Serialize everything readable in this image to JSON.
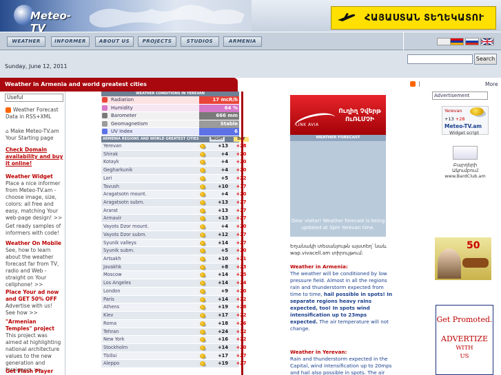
{
  "header": {
    "logo_text": "Meteo-TV",
    "top_ad_text": "ՀԱՅԱՍՏԱՆ ՏԵՂԵԿԱՏՈՒ"
  },
  "nav": {
    "items": [
      "WEATHER",
      "INFORMER",
      "ABOUT US",
      "PROJECTS",
      "STUDIOS",
      "ARMENIA"
    ]
  },
  "search": {
    "button": "Search",
    "value": ""
  },
  "date": "Sunday, June 12, 2011",
  "section_title": "Weather in Armenia and world greatest cities",
  "left": {
    "useful": "Useful",
    "rss_text": "Weather Forecast Data in RSS+XML",
    "start_text": "Make Meteo-TV.am Your Starting page",
    "check_domain": "Check Domain availability and buy it online!",
    "widget_title": "Weather Widget",
    "widget_text": "Place a nice informer from Meteo-TV.am - choose image, size, colors: all free and easy, matching Your web-page design! >>",
    "samples_text": "Get ready samples of informers with code!",
    "mobile_title": "Weather On Mobile",
    "mobile_text": "See, how to learn about the weather forecast far from TV, radio and Web - straight on Your cellphone! >>",
    "ad_title": "Place Your ad now and GET 50% OFF",
    "ad_text": "Advertise with us! See how >>",
    "temples_title": "\"Armenian Temples\" project",
    "temples_text": "This project was aimed at highlighting national architecture values to the new generation and foreigners >>",
    "flash_title": "Get Flash Player"
  },
  "conditions": {
    "header": "WEATHER CONDITIONS IN YEREVAN",
    "rows": [
      {
        "label": "Radiation",
        "value": "17 mcR/h",
        "color": "#e8443a",
        "bg": "#fbe3e3"
      },
      {
        "label": "Humidity",
        "value": "64 %",
        "color": "#d778c8",
        "bg": "#f6e7f3"
      },
      {
        "label": "Barometer",
        "value": "666 mm",
        "color": "#7a7a7a",
        "bg": "#f1f1f1"
      },
      {
        "label": "Geomagnetism",
        "value": "Stable",
        "color": "#9b9b9b",
        "bg": "#f2f2f2"
      },
      {
        "label": "UV Index",
        "value": "6",
        "color": "#5c72e6",
        "bg": "#e6e9fb"
      }
    ]
  },
  "regions": {
    "header": "ARMENIA REGIONS AND WORLD GREATEST CITIES",
    "night_label": "NIGHT",
    "day_label": "DAY",
    "rows": [
      {
        "city": "Yerevan",
        "night": "+13",
        "day": "+28"
      },
      {
        "city": "Shirak",
        "night": "+4",
        "day": "+20"
      },
      {
        "city": "Kotayk",
        "night": "+4",
        "day": "+20"
      },
      {
        "city": "Gegharkunik",
        "night": "+4",
        "day": "+20"
      },
      {
        "city": "Lori",
        "night": "+5",
        "day": "+22"
      },
      {
        "city": "Tavush",
        "night": "+10",
        "day": "+17"
      },
      {
        "city": "Aragatsotn mount.",
        "night": "+4",
        "day": "+20"
      },
      {
        "city": "Aragatsotn subm.",
        "night": "+13",
        "day": "+27"
      },
      {
        "city": "Ararat",
        "night": "+13",
        "day": "+27"
      },
      {
        "city": "Armavir",
        "night": "+13",
        "day": "+27"
      },
      {
        "city": "Vayots Dzor mount.",
        "night": "+4",
        "day": "+20"
      },
      {
        "city": "Vayots Dzor subm.",
        "night": "+12",
        "day": "+27"
      },
      {
        "city": "Syunik valleys",
        "night": "+14",
        "day": "+27"
      },
      {
        "city": "Syunik subm.",
        "night": "+5",
        "day": "+20"
      },
      {
        "city": "Artsakh",
        "night": "+10",
        "day": "+21"
      },
      {
        "city": "Javakhk",
        "night": "+8",
        "day": "+23"
      },
      {
        "city": "Moscow",
        "night": "+14",
        "day": "+25"
      },
      {
        "city": "Los Angeles",
        "night": "+14",
        "day": "+24"
      },
      {
        "city": "London",
        "night": "+9",
        "day": "+20"
      },
      {
        "city": "Paris",
        "night": "+14",
        "day": "+22"
      },
      {
        "city": "Athens",
        "night": "+19",
        "day": "+28"
      },
      {
        "city": "Kiev",
        "night": "+17",
        "day": "+22"
      },
      {
        "city": "Roma",
        "night": "+18",
        "day": "+26"
      },
      {
        "city": "Tehran",
        "night": "+24",
        "day": "+32"
      },
      {
        "city": "New York",
        "night": "+16",
        "day": "+22"
      },
      {
        "city": "Stockholm",
        "night": "+14",
        "day": "+20"
      },
      {
        "city": "Tbilisi",
        "night": "+17",
        "day": "+27"
      },
      {
        "city": "Aleppo",
        "night": "+19",
        "day": "+27"
      }
    ]
  },
  "center_ad": {
    "armenian": "Ուղիղ Չվերթ ՈւՌԼՄՉԻ",
    "brand": "LINK AVIA",
    "forecast_label": "WEATHER FORECAST",
    "note": "Dear visitor! Weather forecast is being updated at 3pm Yerevan time."
  },
  "center_text": {
    "armenian_note": "Եղանակի տեսանյութն այստեղ՝ նաև wap.vivacell.am տիրույթում:",
    "armenia_title": "Weather in Armenia:",
    "armenia_text_1": "The weather will be conditioned by low pressure field. Almost in all the regions rain and thunderstorm expected from time to time,",
    "armenia_text_2": "hail possible in spots! In separate regions heavy rains expected, too! In spots wind intensification up to 23mps expected.",
    "armenia_text_3": "The air temperature will not change.",
    "yerevan_title": "Weather in Yerevan:",
    "yerevan_text": "Rain and thunderstorm expected in the Capital, wind intensification up to 20mps and hail also possible in spots. The air"
  },
  "right": {
    "more": "More",
    "advertisement": "Advertisement",
    "widget_city": "Yerevan",
    "widget_t1": "+13",
    "widget_t2": "+28",
    "widget_brand": "Meteo-TV.am",
    "widget_script": "Widget script",
    "bardclub_arm": "Բարդերի Ակումբում",
    "bardclub_url": "www.BardClub.am",
    "promo_year": "50",
    "get_promoted": "Get Promoted.",
    "advertize": "ADVERTIZE",
    "with": "WITH",
    "us": "US"
  }
}
